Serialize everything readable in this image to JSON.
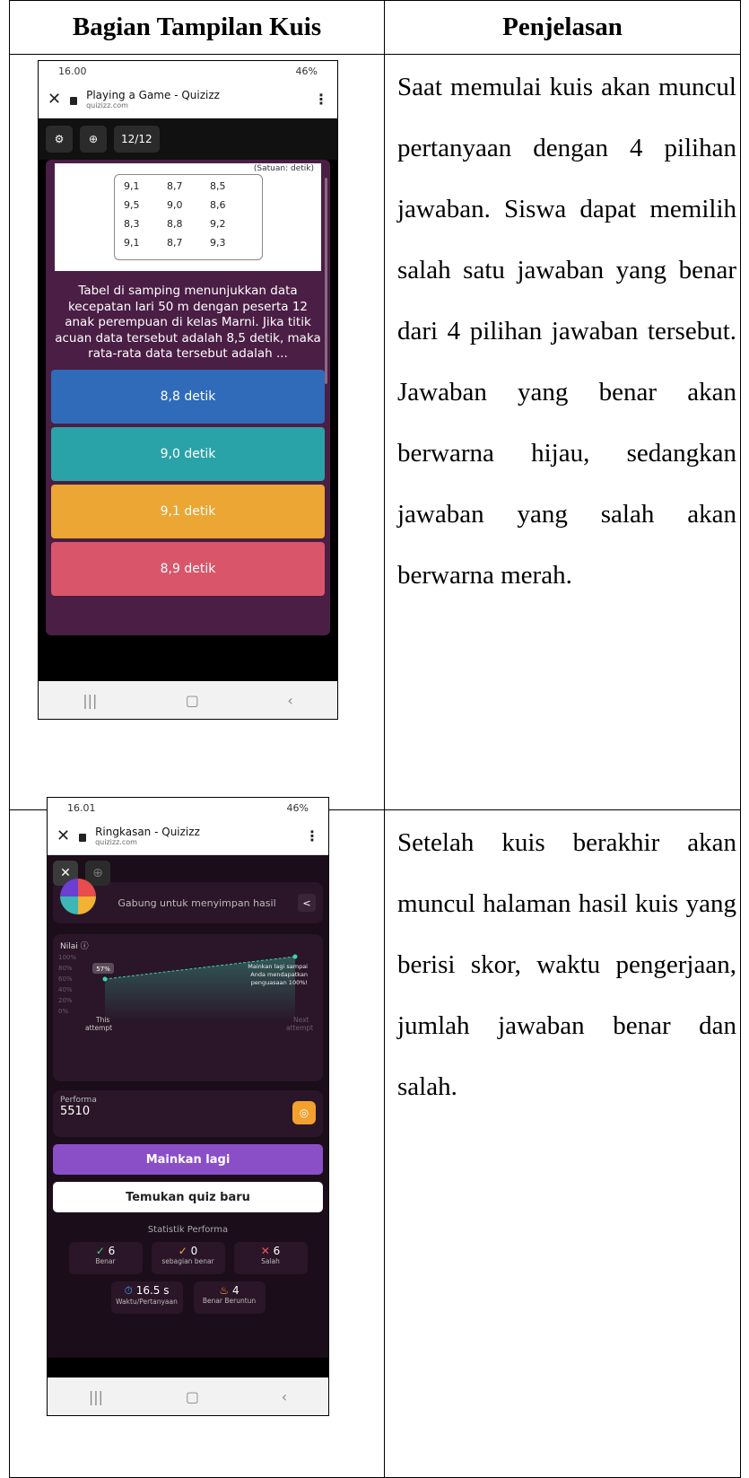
{
  "table": {
    "header_left": "Bagian Tampilan Kuis",
    "header_right": "Penjelasan",
    "row1_text": "Saat memulai kuis akan muncul pertanyaan dengan 4 pilihan jawaban. Siswa dapat memilih salah satu jawaban yang benar dari 4 pilihan jawaban tersebut. Jawaban yang benar akan berwarna hijau, sedangkan jawaban yang salah akan berwarna merah.",
    "row2_text": "Setelah kuis berakhir akan muncul halaman hasil kuis yang berisi skor, waktu pengerjaan, jumlah jawaban benar dan salah."
  },
  "phone1": {
    "time": "16.00",
    "battery": "46%",
    "page_title": "Playing a Game - Quizizz",
    "url": "quizizz.com",
    "counter": "12/12",
    "unit_note": "(Satuan: detik)",
    "data_rows": [
      [
        "9,1",
        "8,7",
        "8,5"
      ],
      [
        "9,5",
        "9,0",
        "8,6"
      ],
      [
        "8,3",
        "8,8",
        "9,2"
      ],
      [
        "9,1",
        "8,7",
        "9,3"
      ]
    ],
    "question": "Tabel di samping menunjukkan data kecepatan lari 50 m dengan peserta 12 anak perempuan di kelas Marni. Jika titik acuan data tersebut adalah 8,5 detik, maka rata-rata data tersebut adalah ...",
    "answers": [
      {
        "label": "8,8 detik",
        "color": "#2f6bb8"
      },
      {
        "label": "9,0 detik",
        "color": "#2aa3a8"
      },
      {
        "label": "9,1 detik",
        "color": "#eba634"
      },
      {
        "label": "8,9 detik",
        "color": "#d9566a"
      }
    ]
  },
  "phone2": {
    "time": "16.01",
    "battery": "46%",
    "page_title": "Ringkasan - Quizizz",
    "url": "quizizz.com",
    "join_text": "Gabung untuk menyimpan hasil",
    "nilai_label": "Nilai",
    "score_badge": "57%",
    "y_ticks": [
      "100%",
      "80%",
      "60%",
      "40%",
      "20%",
      "0%"
    ],
    "x_left_1": "This",
    "x_left_2": "attempt",
    "x_right_1": "Next",
    "x_right_2": "attempt",
    "promo_1": "Mainkan lagi sampai",
    "promo_2": "Anda mendapatkan",
    "promo_3": "penguasaan 100%!",
    "performa_label": "Performa",
    "performa_value": "5510",
    "play_again": "Mainkan lagi",
    "find_quiz": "Temukan quiz baru",
    "stats_title": "Statistik Performa",
    "correct_value": "6",
    "correct_label": "Benar",
    "partial_value": "0",
    "partial_label": "sebagian benar",
    "wrong_value": "6",
    "wrong_label": "Salah",
    "time_value": "16.5 s",
    "time_label": "Waktu/Pertanyaan",
    "streak_value": "4",
    "streak_label": "Benar Beruntun"
  },
  "colors": {
    "correct": "#4ccf7a",
    "wrong": "#e35b5b",
    "purple": "#8a4fc7",
    "teal_line": "#3fd1b0"
  }
}
